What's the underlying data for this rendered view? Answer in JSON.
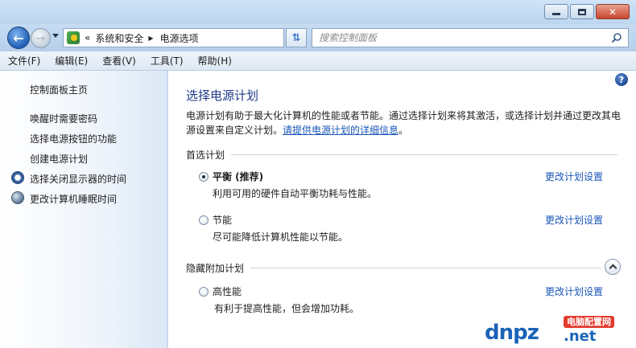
{
  "window": {
    "buttons": {
      "minimize": "minimize",
      "maximize": "maximize",
      "close": "✕"
    }
  },
  "nav": {
    "breadcrumb": [
      "系统和安全",
      "电源选项"
    ],
    "breadcrumb_prefix": "«",
    "search_placeholder": "搜索控制面板"
  },
  "menu": [
    "文件(F)",
    "编辑(E)",
    "查看(V)",
    "工具(T)",
    "帮助(H)"
  ],
  "sidebar": {
    "home": "控制面板主页",
    "links": [
      {
        "label": "唤醒时需要密码",
        "icon": null
      },
      {
        "label": "选择电源按钮的功能",
        "icon": null
      },
      {
        "label": "创建电源计划",
        "icon": null
      },
      {
        "label": "选择关闭显示器的时间",
        "icon": "clock-icon"
      },
      {
        "label": "更改计算机睡眠时间",
        "icon": "moon-icon"
      }
    ]
  },
  "main": {
    "title": "选择电源计划",
    "description": "电源计划有助于最大化计算机的性能或者节能。通过选择计划来将其激活，或选择计划并通过更改其电源设置来自定义计划。",
    "description_link": "请提供电源计划的详细信息",
    "description_end": "。",
    "preferred_section": "首选计划",
    "hidden_section": "隐藏附加计划",
    "plans": [
      {
        "name": "平衡 (推荐)",
        "desc": "利用可用的硬件自动平衡功耗与性能。",
        "link": "更改计划设置",
        "selected": true
      },
      {
        "name": "节能",
        "desc": "尽可能降低计算机性能以节能。",
        "link": "更改计划设置",
        "selected": false
      },
      {
        "name": "高性能",
        "desc": "有利于提高性能，但会增加功耗。",
        "link": "更改计划设置",
        "selected": false
      }
    ]
  },
  "watermark": {
    "tag": "电脑配置网",
    "main": "dnpz",
    "suffix": ".net"
  }
}
